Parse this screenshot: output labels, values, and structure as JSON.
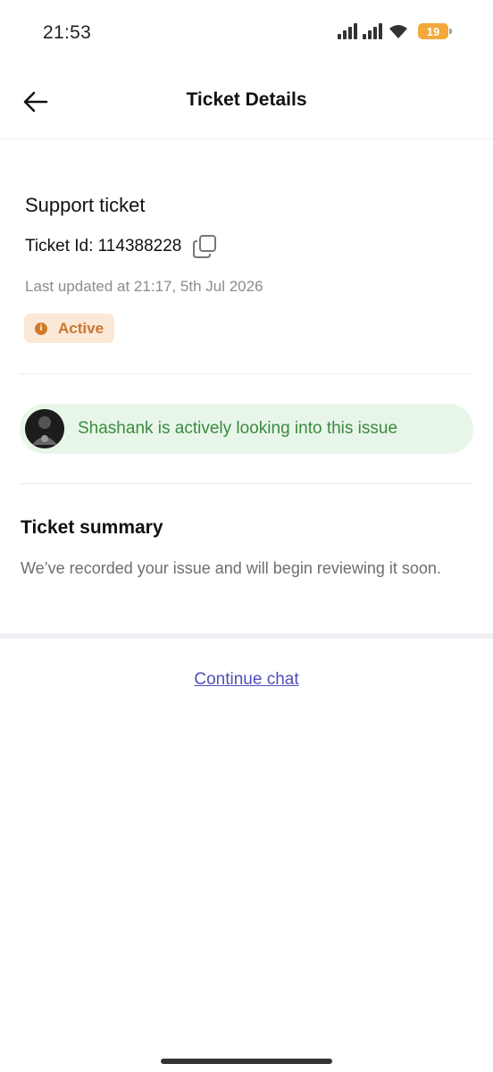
{
  "status_bar": {
    "time": "21:53",
    "battery": "19",
    "icons": [
      "signal-icon",
      "signal-icon",
      "wifi-icon",
      "battery-icon"
    ]
  },
  "header": {
    "title": "Ticket Details",
    "back_icon": "arrow-left-icon"
  },
  "ticket": {
    "type": "Support ticket",
    "id_label": "Ticket Id: 114388228",
    "last_updated": "Last updated at 21:17, 5th Jul 2026",
    "status": "Active",
    "status_icon": "info-icon",
    "copy_icon": "copy-icon"
  },
  "agent_banner": {
    "text": "Shashank is actively looking into this issue"
  },
  "summary": {
    "title": "Ticket summary",
    "text": "We’ve recorded your issue and will begin reviewing it soon."
  },
  "actions": {
    "continue_chat": "Continue chat"
  },
  "colors": {
    "badge_bg": "#fbe8d6",
    "badge_text": "#c9762e",
    "banner_bg": "#e8f6ea",
    "banner_text": "#3b8a3e",
    "link": "#4f4fb8",
    "battery": "#f2a93b"
  }
}
